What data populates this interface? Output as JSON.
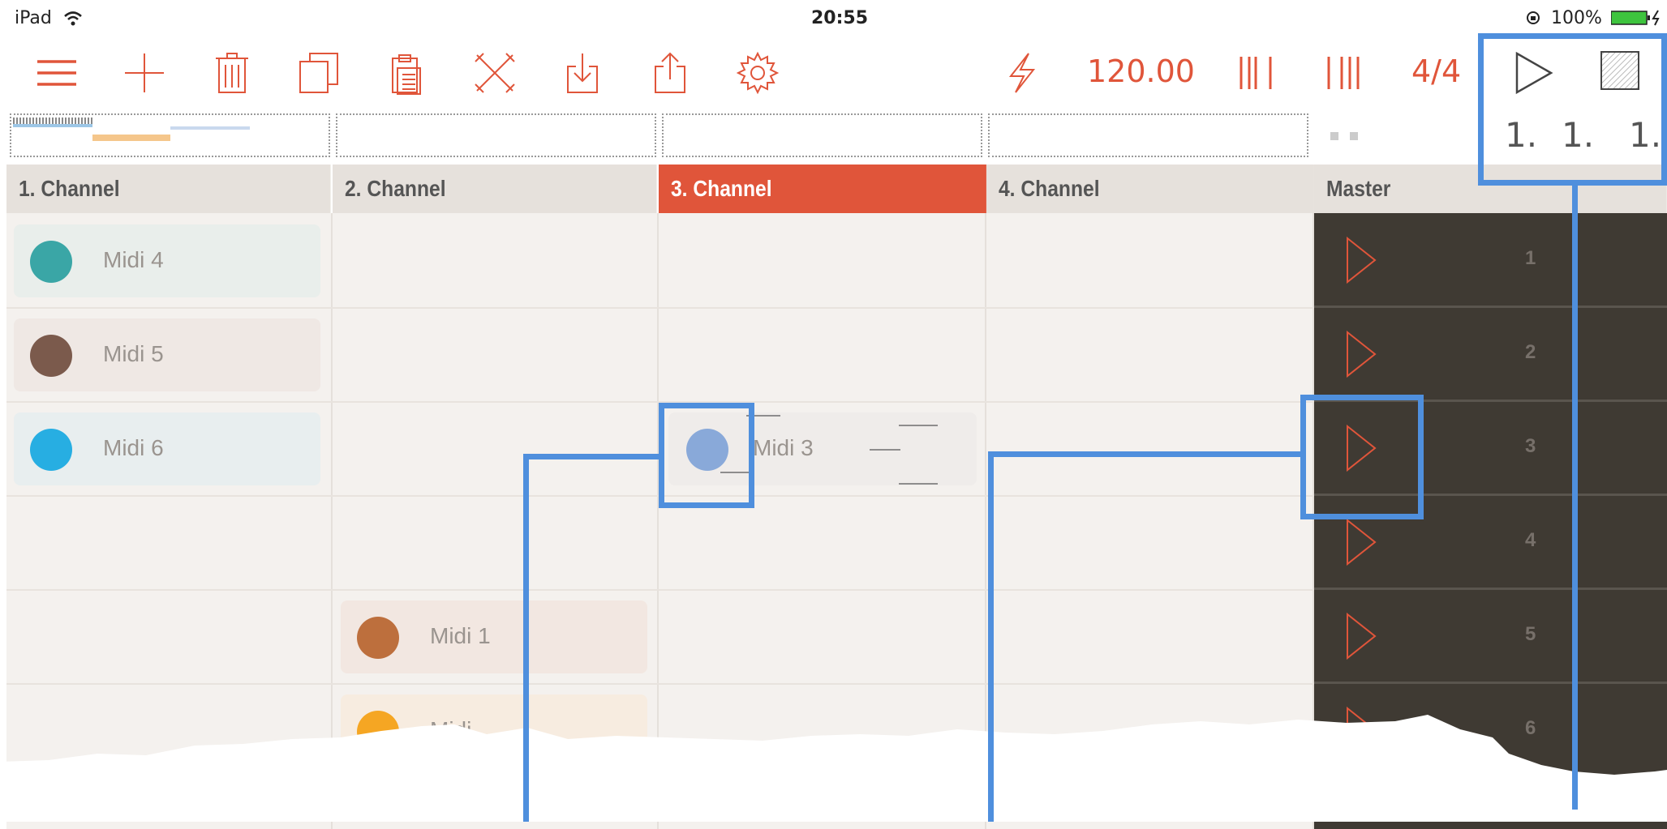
{
  "status_bar": {
    "device": "iPad",
    "time": "20:55",
    "battery": "100%"
  },
  "toolbar": {
    "icons": [
      "menu-icon",
      "plus-icon",
      "trash-icon",
      "copy-icon",
      "paste-icon",
      "cut-icon",
      "import-icon",
      "share-icon",
      "gear-icon",
      "lightning-icon"
    ],
    "tempo": "120.00",
    "time_signature": "4/4",
    "position": [
      "1.",
      "1.",
      "1."
    ]
  },
  "channels": [
    {
      "label": "1. Channel",
      "selected": false
    },
    {
      "label": "2. Channel",
      "selected": false
    },
    {
      "label": "3. Channel",
      "selected": true
    },
    {
      "label": "4. Channel",
      "selected": false
    }
  ],
  "master": {
    "label": "Master",
    "rows": [
      "1",
      "2",
      "3",
      "4",
      "5",
      "6"
    ]
  },
  "clips": [
    {
      "label": "Midi 4",
      "color": "#3aa6a6",
      "bg": "#e9eeeb"
    },
    {
      "label": "Midi 5",
      "color": "#7b5a4c",
      "bg": "#efe8e4"
    },
    {
      "label": "Midi 6",
      "color": "#27aee2",
      "bg": "#e8eeef"
    },
    {
      "label": "Midi 3",
      "color": "#89a9d9",
      "bg": "#efecea"
    },
    {
      "label": "Midi 1",
      "color": "#bd6f3d",
      "bg": "#f2e7e1"
    },
    {
      "label": "Midi",
      "color": "#f5a623",
      "bg": "#f7ece0"
    }
  ],
  "colors": {
    "accent": "#e0553a",
    "highlight": "#4f8fdd",
    "master_bg": "#3f3a33"
  }
}
